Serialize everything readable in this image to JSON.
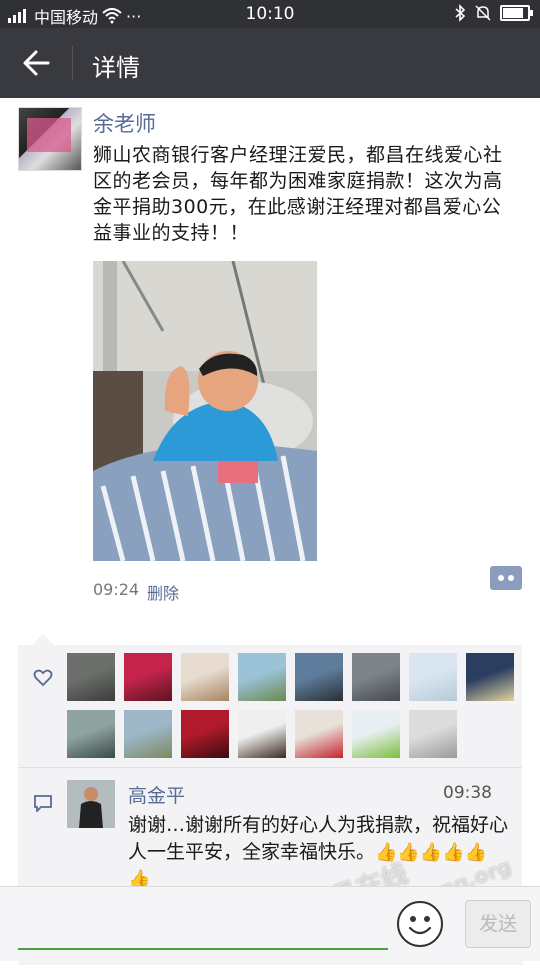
{
  "status_bar": {
    "carrier": "中国移动",
    "time": "10:10",
    "battery_level": 0.9,
    "icons": [
      "signal-icon",
      "wifi-icon",
      "more-icon",
      "bluetooth-icon",
      "mute-icon",
      "battery-icon"
    ]
  },
  "nav": {
    "title": "详情"
  },
  "post": {
    "author": "余老师",
    "text": "狮山农商银行客户经理汪爱民，都昌在线爱心社区的老会员，每年都为困难家庭捐款！这次为高金平捐助300元，在此感谢汪经理对都昌爱心公益事业的支持！！",
    "time": "09:24",
    "delete_label": "删除"
  },
  "likes": {
    "count": 15
  },
  "comment": {
    "author": "高金平",
    "time": "09:38",
    "text": "谢谢…谢谢所有的好心人为我捐款，祝福好心人一生平安，全家幸福快乐。",
    "emoji": "👍👍👍👍👍👍"
  },
  "input": {
    "placeholder": "",
    "send_label": "发送"
  },
  "watermark": {
    "text": "都昌在线",
    "url": "www.duchang.org"
  },
  "colors": {
    "nav_bg": "#393a3f",
    "link": "#576b95",
    "accent_green": "#4aa33e"
  }
}
